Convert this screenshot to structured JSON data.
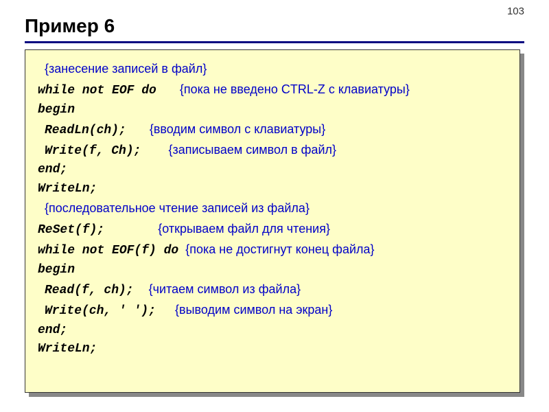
{
  "page_number": "103",
  "title": "Пример 6",
  "code": {
    "l1_comment": "{занесение записей в файл}",
    "l2_kw": "while not EOF do",
    "l2_comment": "{пока не введено CTRL-Z с клавиатуры}",
    "l3_kw": "begin",
    "l4_kw": "ReadLn(ch);",
    "l4_comment": "{вводим символ с клавиатуры}",
    "l5_kw": "Write(f, Ch);",
    "l5_comment": "{записываем символ в файл}",
    "l6_kw": "end;",
    "l7_kw": "WriteLn;",
    "l8_comment": "{последовательное чтение записей из файла}",
    "l9_kw": "ReSet(f);",
    "l9_comment": "{открываем файл для чтения}",
    "l10_kw": "while not EOF(f) do",
    "l10_comment": "{пока не достигнут конец файла}",
    "l11_kw": "begin",
    "l12_kw": "Read(f, ch);",
    "l12_comment": "{читаем символ из файла}",
    "l13_kw": "Write(ch, ' ');",
    "l13_comment": "{выводим символ на экран}",
    "l14_kw": "end;",
    "l15_kw": "WriteLn;"
  }
}
